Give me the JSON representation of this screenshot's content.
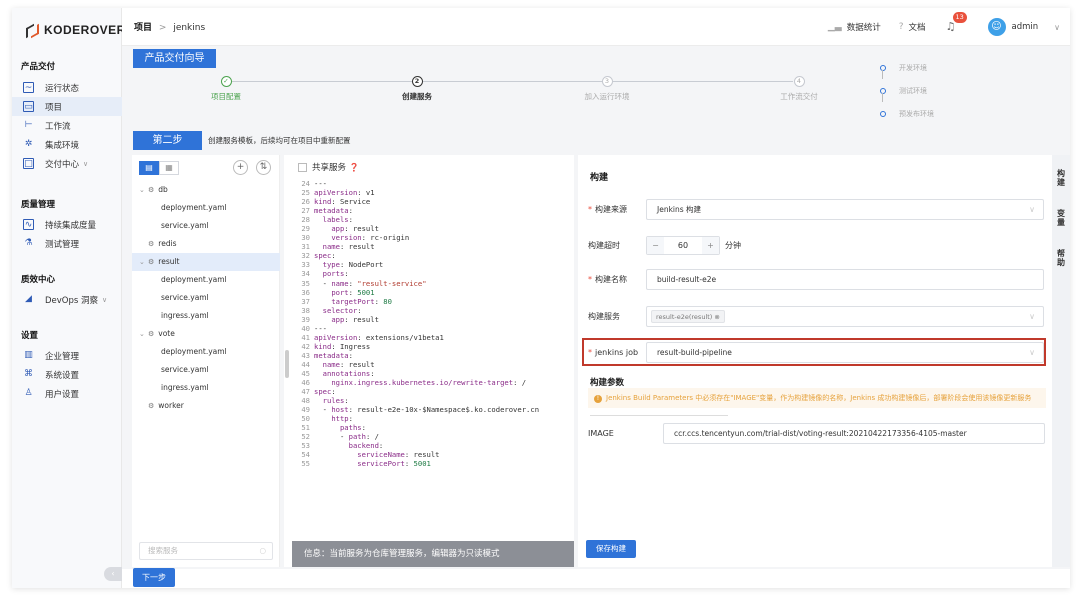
{
  "brand": {
    "name": "KODEROVER"
  },
  "sidebar": {
    "groups": [
      {
        "title": "产品交付",
        "items": [
          {
            "label": "运行状态",
            "icon": "pulse-icon"
          },
          {
            "label": "项目",
            "icon": "project-icon",
            "active": true
          },
          {
            "label": "工作流",
            "icon": "workflow-icon"
          },
          {
            "label": "集成环境",
            "icon": "environment-icon"
          },
          {
            "label": "交付中心",
            "icon": "delivery-icon",
            "caret": "∨"
          }
        ]
      },
      {
        "title": "质量管理",
        "items": [
          {
            "label": "持续集成度量",
            "icon": "metrics-icon"
          },
          {
            "label": "测试管理",
            "icon": "test-icon"
          }
        ]
      },
      {
        "title": "质效中心",
        "items": [
          {
            "label": "DevOps 洞察",
            "icon": "insight-icon",
            "caret": "∨"
          }
        ]
      },
      {
        "title": "设置",
        "items": [
          {
            "label": "企业管理",
            "icon": "enterprise-icon"
          },
          {
            "label": "系统设置",
            "icon": "settings-icon"
          },
          {
            "label": "用户设置",
            "icon": "user-icon"
          }
        ]
      }
    ]
  },
  "header": {
    "crumb_root": "项目",
    "crumb_sep": ">",
    "crumb_current": "jenkins",
    "stats": "数据统计",
    "docs": "文档",
    "notifications": "13",
    "user": "admin"
  },
  "wizard": {
    "title": "产品交付向导",
    "steps": [
      {
        "num": "✓",
        "label": "项目配置",
        "state": "done"
      },
      {
        "num": "2",
        "label": "创建服务",
        "state": "current"
      },
      {
        "num": "3",
        "label": "加入运行环境",
        "state": "todo"
      },
      {
        "num": "4",
        "label": "工作流交付",
        "state": "todo"
      }
    ],
    "envs": [
      "开发环境",
      "测试环境",
      "预发布环境"
    ],
    "stage_label": "第二步",
    "stage_desc": "创建服务模板，后续均可在项目中重新配置",
    "next_label": "下一步"
  },
  "tree": {
    "search_placeholder": "搜索服务",
    "rows": [
      {
        "type": "folder",
        "name": "db",
        "open": true
      },
      {
        "type": "file",
        "name": "deployment.yaml"
      },
      {
        "type": "file",
        "name": "service.yaml"
      },
      {
        "type": "folder",
        "name": "redis",
        "open": false
      },
      {
        "type": "folder",
        "name": "result",
        "open": true,
        "selected": true
      },
      {
        "type": "file",
        "name": "deployment.yaml"
      },
      {
        "type": "file",
        "name": "service.yaml"
      },
      {
        "type": "file",
        "name": "ingress.yaml"
      },
      {
        "type": "folder",
        "name": "vote",
        "open": true
      },
      {
        "type": "file",
        "name": "deployment.yaml"
      },
      {
        "type": "file",
        "name": "service.yaml"
      },
      {
        "type": "file",
        "name": "ingress.yaml"
      },
      {
        "type": "folder",
        "name": "worker",
        "open": false
      }
    ]
  },
  "editor": {
    "shared_label": "共享服务",
    "footer": "信息：当前服务为仓库管理服务，编辑器为只读模式",
    "lines": [
      {
        "n": "24",
        "t": "---"
      },
      {
        "n": "25",
        "t": "apiVersion: v1"
      },
      {
        "n": "26",
        "t": "kind: Service"
      },
      {
        "n": "27",
        "t": "metadata:"
      },
      {
        "n": "28",
        "t": "  labels:"
      },
      {
        "n": "29",
        "t": "    app: result"
      },
      {
        "n": "30",
        "t": "    version: rc-origin"
      },
      {
        "n": "31",
        "t": "  name: result"
      },
      {
        "n": "32",
        "t": "spec:"
      },
      {
        "n": "33",
        "t": "  type: NodePort"
      },
      {
        "n": "34",
        "t": "  ports:"
      },
      {
        "n": "35",
        "t": "  - name: \"result-service\""
      },
      {
        "n": "36",
        "t": "    port: 5001"
      },
      {
        "n": "37",
        "t": "    targetPort: 80"
      },
      {
        "n": "38",
        "t": "  selector:"
      },
      {
        "n": "39",
        "t": "    app: result"
      },
      {
        "n": "40",
        "t": "---"
      },
      {
        "n": "41",
        "t": "apiVersion: extensions/v1beta1"
      },
      {
        "n": "42",
        "t": "kind: Ingress"
      },
      {
        "n": "43",
        "t": "metadata:"
      },
      {
        "n": "44",
        "t": "  name: result"
      },
      {
        "n": "45",
        "t": "  annotations:"
      },
      {
        "n": "46",
        "t": "    nginx.ingress.kubernetes.io/rewrite-target: /"
      },
      {
        "n": "47",
        "t": "spec:"
      },
      {
        "n": "48",
        "t": "  rules:"
      },
      {
        "n": "49",
        "t": "  - host: result-e2e-10x-$Namespace$.ko.coderover.cn"
      },
      {
        "n": "50",
        "t": "    http:"
      },
      {
        "n": "51",
        "t": "      paths:"
      },
      {
        "n": "52",
        "t": "      - path: /"
      },
      {
        "n": "53",
        "t": "        backend:"
      },
      {
        "n": "54",
        "t": "          serviceName: result"
      },
      {
        "n": "55",
        "t": "          servicePort: 5001"
      }
    ]
  },
  "build": {
    "title": "构建",
    "source_label": "构建来源",
    "source_value": "Jenkins 构建",
    "timeout_label": "构建超时",
    "timeout_minus": "−",
    "timeout_value": "60",
    "timeout_plus": "+",
    "timeout_unit": "分钟",
    "name_label": "构建名称",
    "name_value": "build-result-e2e",
    "service_label": "构建服务",
    "service_tag": "result-e2e(result)",
    "job_label": "jenkins job",
    "job_value": "result-build-pipeline",
    "params_title": "构建参数",
    "warning": "Jenkins Build Parameters 中必须存在\"IMAGE\"变量，作为构建镜像的名称，Jenkins 成功构建镜像后，部署阶段会使用该镜像更新服务",
    "param_name": "IMAGE",
    "param_value": "ccr.ccs.tencentyun.com/trial-dist/voting-result:20210422173356-4105-master",
    "save_label": "保存构建"
  },
  "side_tabs": [
    "构建",
    "变量",
    "帮助"
  ],
  "colors": {
    "primary": "#2f73d8",
    "success": "#4ca34f",
    "danger": "#c0392b",
    "warning": "#e6a23c"
  }
}
